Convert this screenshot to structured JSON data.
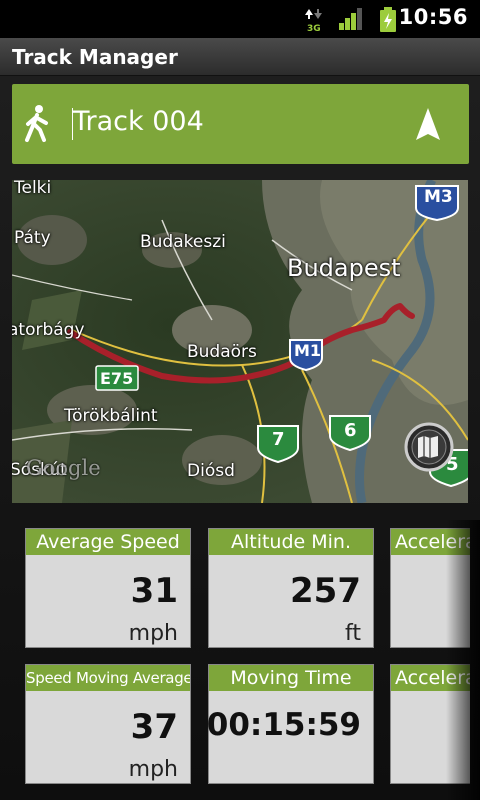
{
  "status_bar": {
    "network_label": "3G",
    "time": "10:56"
  },
  "app": {
    "title": "Track Manager"
  },
  "track": {
    "name": "Track 004",
    "activity_icon": "walking-icon",
    "action_icon": "navigation-arrow-icon"
  },
  "map": {
    "labels": {
      "telki": "Telki",
      "paty": "Páty",
      "budakeszi": "Budakeszi",
      "budapest": "Budapest",
      "torbagy": "atorbágy",
      "budaors": "Budaörs",
      "torokbalint": "Törökbálint",
      "sosku": "Sóskút",
      "diosd": "Diósd"
    },
    "shields": {
      "m3": "M3",
      "m1": "M1",
      "e75": "E75",
      "r7": "7",
      "r6": "6",
      "r5": "5"
    },
    "attribution": "Google",
    "route_color": "#a8202a"
  },
  "stats": [
    {
      "label": "Average Speed",
      "value": "31",
      "unit": "mph"
    },
    {
      "label": "Altitude Min.",
      "value": "257",
      "unit": "ft"
    },
    {
      "label": "Accelera",
      "value": "",
      "unit": ""
    },
    {
      "label": "Speed Moving Average",
      "value": "37",
      "unit": "mph"
    },
    {
      "label": "Moving Time",
      "value": "00:15:59",
      "unit": ""
    },
    {
      "label": "Accelera",
      "value": "",
      "unit": ""
    }
  ],
  "colors": {
    "accent": "#7ea63a",
    "card_bg": "#d9d9d9"
  }
}
